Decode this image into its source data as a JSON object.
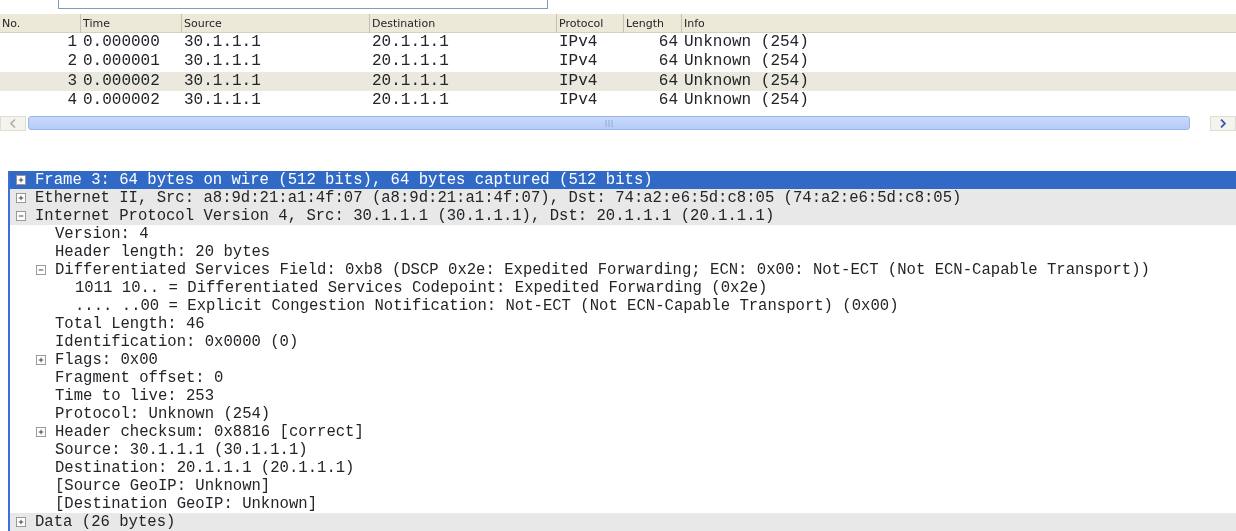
{
  "packet_list": {
    "columns": [
      "No.",
      "Time",
      "Source",
      "Destination",
      "Protocol",
      "Length",
      "Info"
    ],
    "rows": [
      {
        "cells": [
          "1",
          "0.000000",
          "30.1.1.1",
          "20.1.1.1",
          "IPv4",
          "64",
          "Unknown (254)"
        ],
        "selected": false
      },
      {
        "cells": [
          "2",
          "0.000001",
          "30.1.1.1",
          "20.1.1.1",
          "IPv4",
          "64",
          "Unknown (254)"
        ],
        "selected": false
      },
      {
        "cells": [
          "3",
          "0.000002",
          "30.1.1.1",
          "20.1.1.1",
          "IPv4",
          "64",
          "Unknown (254)"
        ],
        "selected": true
      },
      {
        "cells": [
          "4",
          "0.000002",
          "30.1.1.1",
          "20.1.1.1",
          "IPv4",
          "64",
          "Unknown (254)"
        ],
        "selected": false
      }
    ]
  },
  "details_tree": [
    {
      "text": "Frame 3: 64 bytes on wire (512 bits), 64 bytes captured (512 bits)",
      "expanded": false,
      "selected": true
    },
    {
      "text": "Ethernet II, Src: a8:9d:21:a1:4f:07 (a8:9d:21:a1:4f:07), Dst: 74:a2:e6:5d:c8:05 (74:a2:e6:5d:c8:05)",
      "expanded": false,
      "selected": false
    },
    {
      "text": "Internet Protocol Version 4, Src: 30.1.1.1 (30.1.1.1), Dst: 20.1.1.1 (20.1.1.1)",
      "expanded": true,
      "selected": false,
      "children": [
        {
          "text": "Version: 4",
          "selected": false
        },
        {
          "text": "Header length: 20 bytes",
          "selected": false
        },
        {
          "text": "Differentiated Services Field: 0xb8 (DSCP 0x2e: Expedited Forwarding; ECN: 0x00: Not-ECT (Not ECN-Capable Transport))",
          "expanded": true,
          "selected": false,
          "children": [
            {
              "text": "1011 10.. = Differentiated Services Codepoint: Expedited Forwarding (0x2e)",
              "selected": false
            },
            {
              "text": ".... ..00 = Explicit Congestion Notification: Not-ECT (Not ECN-Capable Transport) (0x00)",
              "selected": false
            }
          ]
        },
        {
          "text": "Total Length: 46",
          "selected": false
        },
        {
          "text": "Identification: 0x0000 (0)",
          "selected": false
        },
        {
          "text": "Flags: 0x00",
          "expanded": false,
          "selected": false
        },
        {
          "text": "Fragment offset: 0",
          "selected": false
        },
        {
          "text": "Time to live: 253",
          "selected": false
        },
        {
          "text": "Protocol: Unknown (254)",
          "selected": false
        },
        {
          "text": "Header checksum: 0x8816 [correct]",
          "expanded": false,
          "selected": false
        },
        {
          "text": "Source: 30.1.1.1 (30.1.1.1)",
          "selected": false
        },
        {
          "text": "Destination: 20.1.1.1 (20.1.1.1)",
          "selected": false
        },
        {
          "text": "[Source GeoIP: Unknown]",
          "selected": false
        },
        {
          "text": "[Destination GeoIP: Unknown]",
          "selected": false
        }
      ]
    },
    {
      "text": "Data (26 bytes)",
      "expanded": false,
      "selected": false
    }
  ]
}
